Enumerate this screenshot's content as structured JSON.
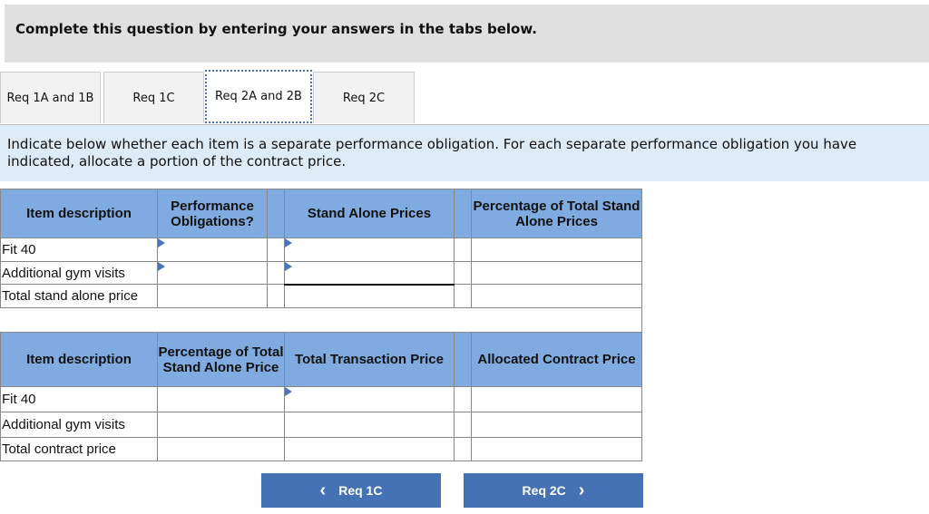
{
  "banner": "Complete this question by entering your answers in the tabs below.",
  "tabs": [
    {
      "label": "Req 1A and 1B"
    },
    {
      "label": "Req 1C"
    },
    {
      "label": "Req 2A and 2B",
      "active": true
    },
    {
      "label": "Req 2C"
    }
  ],
  "instructions": "Indicate below whether each item is a separate performance obligation. For each separate performance obligation you have indicated, allocate a portion of the contract price.",
  "table1": {
    "headers": [
      "Item description",
      "Performance Obligations?",
      "Stand Alone Prices",
      "Percentage of Total Stand Alone Prices"
    ],
    "rows": [
      "Fit 40",
      "Additional gym visits",
      "Total stand alone price"
    ]
  },
  "table2": {
    "headers": [
      "Item description",
      "Percentage of Total Stand Alone Price",
      "Total Transaction Price",
      "Allocated Contract Price"
    ],
    "rows": [
      "Fit 40",
      "Additional gym visits",
      "Total contract price"
    ]
  },
  "nav": {
    "prev": "Req 1C",
    "next": "Req 2C",
    "prev_icon": "‹",
    "next_icon": "›"
  },
  "colors": {
    "header": "#80abe1",
    "button": "#4472b4",
    "instructions_bg": "#ddebf7"
  }
}
